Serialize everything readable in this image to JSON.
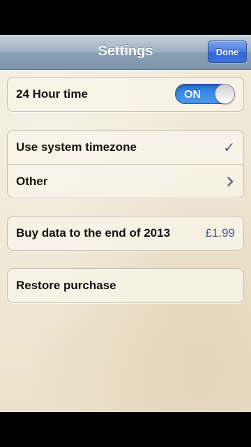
{
  "nav": {
    "title": "Settings",
    "done_label": "Done"
  },
  "time_section": {
    "label": "24 Hour time",
    "toggle_state": "ON"
  },
  "timezone_section": {
    "items": [
      {
        "label": "Use system timezone",
        "accessory": "checkmark-icon"
      },
      {
        "label": "Other",
        "accessory": "chevron-right-icon"
      }
    ]
  },
  "purchase": {
    "label": "Buy data to the end of 2013",
    "price": "£1.99"
  },
  "restore": {
    "label": "Restore purchase"
  },
  "colors": {
    "accent": "#3d5f8e",
    "toggle_on": "#3a8ae8",
    "done_button": "#4c7de2",
    "background": "#f0e8d6"
  }
}
